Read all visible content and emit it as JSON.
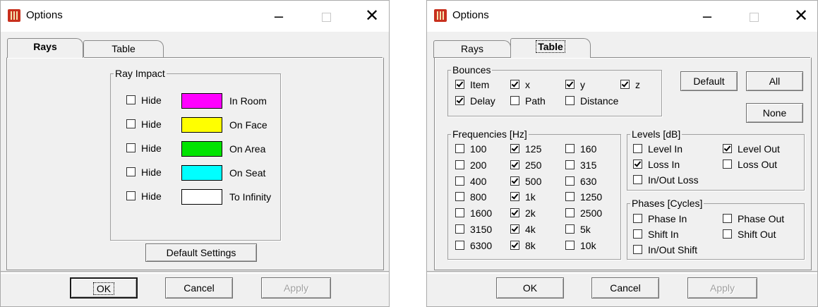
{
  "window1": {
    "title": "Options",
    "tabs": [
      {
        "label": "Rays"
      },
      {
        "label": "Table"
      }
    ],
    "ray_impact": {
      "legend": "Ray Impact",
      "rows": [
        {
          "hide_label": "Hide",
          "label": "In Room",
          "color": "#ff00ff"
        },
        {
          "hide_label": "Hide",
          "label": "On Face",
          "color": "#ffff00"
        },
        {
          "hide_label": "Hide",
          "label": "On Area",
          "color": "#00e400"
        },
        {
          "hide_label": "Hide",
          "label": "On Seat",
          "color": "#00ffff"
        },
        {
          "hide_label": "Hide",
          "label": "To Infinity",
          "color": "#ffffff"
        }
      ]
    },
    "default_settings_label": "Default Settings",
    "buttons": {
      "ok": "OK",
      "cancel": "Cancel",
      "apply": "Apply"
    }
  },
  "window2": {
    "title": "Options",
    "tabs": [
      {
        "label": "Rays"
      },
      {
        "label": "Table"
      }
    ],
    "bounces": {
      "legend": "Bounces",
      "items": [
        {
          "label": "Item",
          "checked": true
        },
        {
          "label": "x",
          "checked": true
        },
        {
          "label": "y",
          "checked": true
        },
        {
          "label": "z",
          "checked": true
        },
        {
          "label": "Delay",
          "checked": true
        },
        {
          "label": "Path",
          "checked": false
        },
        {
          "label": "Distance",
          "checked": false
        }
      ]
    },
    "side_buttons": {
      "default": "Default",
      "all": "All",
      "none": "None"
    },
    "frequencies": {
      "legend": "Frequencies [Hz]",
      "items": [
        {
          "label": "100",
          "checked": false
        },
        {
          "label": "125",
          "checked": true
        },
        {
          "label": "160",
          "checked": false
        },
        {
          "label": "200",
          "checked": false
        },
        {
          "label": "250",
          "checked": true
        },
        {
          "label": "315",
          "checked": false
        },
        {
          "label": "400",
          "checked": false
        },
        {
          "label": "500",
          "checked": true
        },
        {
          "label": "630",
          "checked": false
        },
        {
          "label": "800",
          "checked": false
        },
        {
          "label": "1k",
          "checked": true
        },
        {
          "label": "1250",
          "checked": false
        },
        {
          "label": "1600",
          "checked": false
        },
        {
          "label": "2k",
          "checked": true
        },
        {
          "label": "2500",
          "checked": false
        },
        {
          "label": "3150",
          "checked": false
        },
        {
          "label": "4k",
          "checked": true
        },
        {
          "label": "5k",
          "checked": false
        },
        {
          "label": "6300",
          "checked": false
        },
        {
          "label": "8k",
          "checked": true
        },
        {
          "label": "10k",
          "checked": false
        }
      ]
    },
    "levels": {
      "legend": "Levels [dB]",
      "items": [
        {
          "label": "Level In",
          "checked": false
        },
        {
          "label": "Level Out",
          "checked": true
        },
        {
          "label": "Loss In",
          "checked": true
        },
        {
          "label": "Loss Out",
          "checked": false
        },
        {
          "label": "In/Out Loss",
          "checked": false
        }
      ]
    },
    "phases": {
      "legend": "Phases [Cycles]",
      "items": [
        {
          "label": "Phase In",
          "checked": false
        },
        {
          "label": "Phase Out",
          "checked": false
        },
        {
          "label": "Shift In",
          "checked": false
        },
        {
          "label": "Shift Out",
          "checked": false
        },
        {
          "label": "In/Out Shift",
          "checked": false
        }
      ]
    },
    "buttons": {
      "ok": "OK",
      "cancel": "Cancel",
      "apply": "Apply"
    }
  }
}
